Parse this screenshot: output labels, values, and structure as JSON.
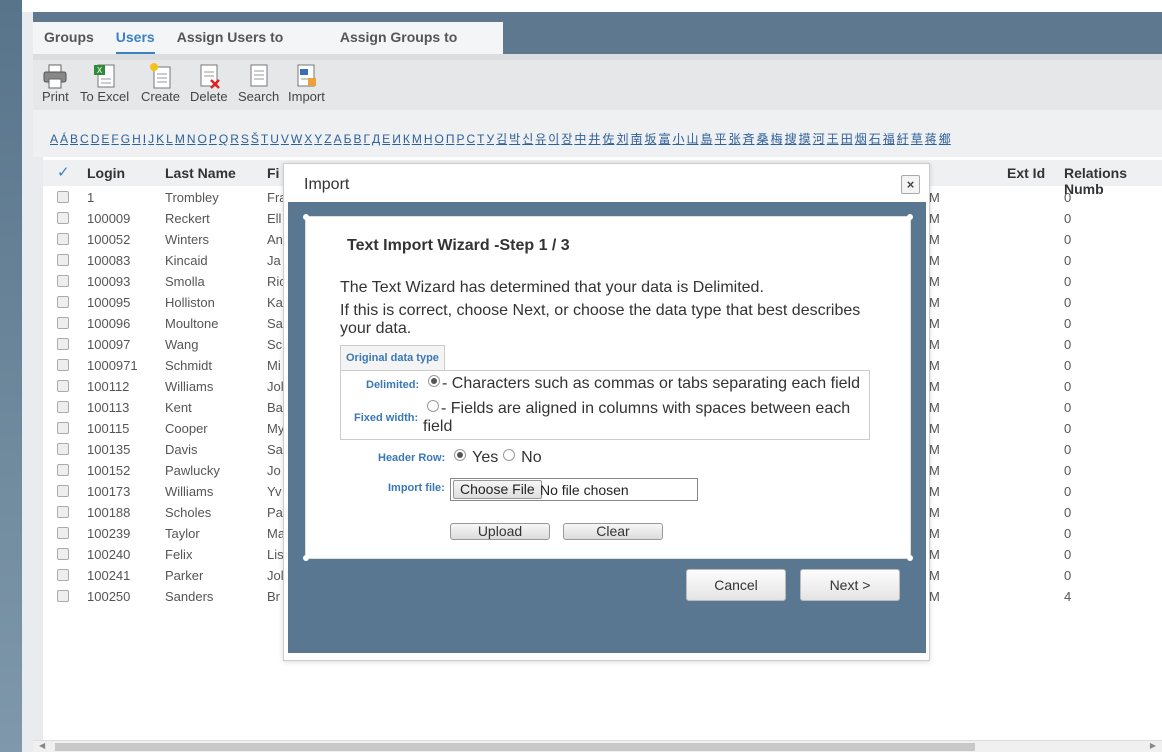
{
  "tabs": [
    "Groups",
    "Users",
    "Assign Users to Groups",
    "Assign Groups to Users"
  ],
  "active_tab": "Users",
  "toolbar": {
    "print": "Print",
    "excel": "To Excel",
    "create": "Create",
    "delete": "Delete",
    "search": "Search",
    "import": "Import"
  },
  "alphabet": [
    "A",
    "Á",
    "B",
    "C",
    "D",
    "E",
    "F",
    "G",
    "H",
    "I",
    "J",
    "K",
    "L",
    "M",
    "N",
    "O",
    "P",
    "Q",
    "R",
    "S",
    "Š",
    "T",
    "U",
    "V",
    "W",
    "X",
    "Y",
    "Z",
    "А",
    "Б",
    "В",
    "Г",
    "Д",
    "Е",
    "И",
    "К",
    "М",
    "Н",
    "О",
    "П",
    "Р",
    "С",
    "Т",
    "У",
    "김",
    "박",
    "신",
    "유",
    "이",
    "장",
    "中",
    "井",
    "佐",
    "刘",
    "南",
    "坂",
    "富",
    "小",
    "山",
    "島",
    "平",
    "张",
    "斉",
    "桑",
    "梅",
    "搜",
    "摸",
    "河",
    "王",
    "田",
    "烟",
    "石",
    "福",
    "紆",
    "草",
    "蒋",
    "鄉"
  ],
  "grid": {
    "headers": {
      "check": "✓",
      "login": "Login",
      "last_name": "Last Name",
      "first_name": "Fi",
      "ext_id": "Ext Id",
      "relations": "Relations Numb"
    },
    "rows": [
      {
        "login": "1",
        "last": "Trombley",
        "first": "Fra",
        "mid": "M",
        "rel": "0"
      },
      {
        "login": "100009",
        "last": "Reckert",
        "first": "Ell",
        "mid": "M",
        "rel": "0"
      },
      {
        "login": "100052",
        "last": "Winters",
        "first": "An",
        "mid": "M",
        "rel": "0"
      },
      {
        "login": "100083",
        "last": "Kincaid",
        "first": "Ja",
        "mid": "M",
        "rel": "0"
      },
      {
        "login": "100093",
        "last": "Smolla",
        "first": "Ric",
        "mid": "M",
        "rel": "0"
      },
      {
        "login": "100095",
        "last": "Holliston",
        "first": "Ka",
        "mid": "M",
        "rel": "0"
      },
      {
        "login": "100096",
        "last": "Moultone",
        "first": "Sa",
        "mid": "M",
        "rel": "0"
      },
      {
        "login": "100097",
        "last": "Wang",
        "first": "Sc",
        "mid": "M",
        "rel": "0"
      },
      {
        "login": "1000971",
        "last": "Schmidt",
        "first": "Mi",
        "mid": "M",
        "rel": "0"
      },
      {
        "login": "100112",
        "last": "Williams",
        "first": "Jol",
        "mid": "M",
        "rel": "0"
      },
      {
        "login": "100113",
        "last": "Kent",
        "first": "Ba",
        "mid": "M",
        "rel": "0"
      },
      {
        "login": "100115",
        "last": "Cooper",
        "first": "My",
        "mid": "M",
        "rel": "0"
      },
      {
        "login": "100135",
        "last": "Davis",
        "first": "Sa",
        "mid": "M",
        "rel": "0"
      },
      {
        "login": "100152",
        "last": "Pawlucky",
        "first": "Jo",
        "mid": "M",
        "rel": "0"
      },
      {
        "login": "100173",
        "last": "Williams",
        "first": "Yv",
        "mid": "M",
        "rel": "0"
      },
      {
        "login": "100188",
        "last": "Scholes",
        "first": "Pa",
        "mid": "M",
        "rel": "0"
      },
      {
        "login": "100239",
        "last": "Taylor",
        "first": "Ma",
        "mid": "M",
        "rel": "0"
      },
      {
        "login": "100240",
        "last": "Felix",
        "first": "Lis",
        "mid": "M",
        "rel": "0"
      },
      {
        "login": "100241",
        "last": "Parker",
        "first": "Jol",
        "mid": "M",
        "rel": "0"
      },
      {
        "login": "100250",
        "last": "Sanders",
        "first": "Br",
        "mid": "M",
        "rel": "4"
      }
    ]
  },
  "modal": {
    "title": "Import",
    "close": "×",
    "wizard_title": "Text Import Wizard -Step 1 / 3",
    "intro1": "The Text Wizard has determined that your data is Delimited.",
    "intro2": "If this is correct, choose Next, or choose the data type that best describes your data.",
    "legend": "Original data type",
    "delimited_label": "Delimited:",
    "delimited_text": "- Characters such as commas or tabs separating each field",
    "fixed_label": "Fixed width:",
    "fixed_text": "- Fields are aligned in columns with spaces between each field",
    "header_row_label": "Header Row:",
    "yes": "Yes",
    "no": "No",
    "import_file_label": "Import file:",
    "choose_file": "Choose File",
    "no_file": "No file chosen",
    "upload": "Upload",
    "clear": "Clear",
    "cancel": "Cancel",
    "next": "Next >"
  }
}
